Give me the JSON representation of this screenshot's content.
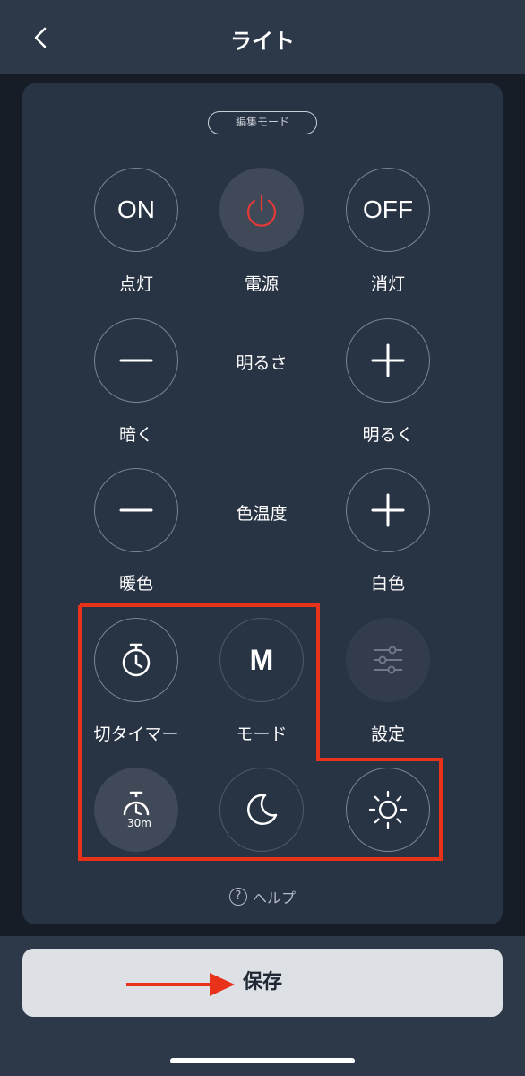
{
  "header": {
    "title": "ライト"
  },
  "panel": {
    "edit_mode": "編集モード",
    "row1": {
      "on_text": "ON",
      "on_label": "点灯",
      "power_label": "電源",
      "off_text": "OFF",
      "off_label": "消灯"
    },
    "brightness": {
      "title": "明るさ",
      "dark_label": "暗く",
      "bright_label": "明るく"
    },
    "color_temp": {
      "title": "色温度",
      "warm_label": "暖色",
      "white_label": "白色"
    },
    "row4": {
      "timer_label": "切タイマー",
      "mode_text": "M",
      "mode_label": "モード",
      "settings_label": "設定"
    },
    "row5": {
      "timer30_text": "30m"
    },
    "help": "ヘルプ",
    "help_icon": "?"
  },
  "footer": {
    "save_label": "保存"
  },
  "colors": {
    "accent_red": "#e8321a",
    "power_red": "#e53935"
  }
}
